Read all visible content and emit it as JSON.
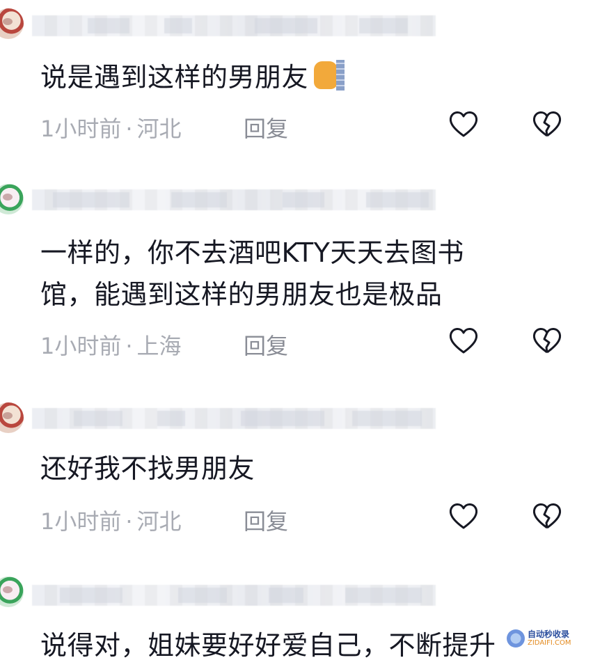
{
  "comments": [
    {
      "text": "说是遇到这样的男朋友",
      "has_emoji": true,
      "emoji": "cat-peeking-emoji",
      "time": "1小时前",
      "location": "河北",
      "reply_label": "回复"
    },
    {
      "text_line1": "一样的，你不去酒吧KTY天天去图书",
      "text_line2": "馆，能遇到这样的男朋友也是极品",
      "time": "1小时前",
      "location": "上海",
      "reply_label": "回复"
    },
    {
      "text": "还好我不找男朋友",
      "time": "1小时前",
      "location": "河北",
      "reply_label": "回复"
    },
    {
      "text": "说得对，姐妹要好好爱自己，不断提升"
    }
  ],
  "separator": "·",
  "icons": {
    "like": "heart-outline-icon",
    "dislike": "broken-heart-icon"
  },
  "watermark": {
    "title": "自动秒收录",
    "url": "ZIDAIFI.COM"
  },
  "colors": {
    "text": "#161823",
    "meta": "#a8abb3",
    "icon_stroke": "#161823"
  }
}
